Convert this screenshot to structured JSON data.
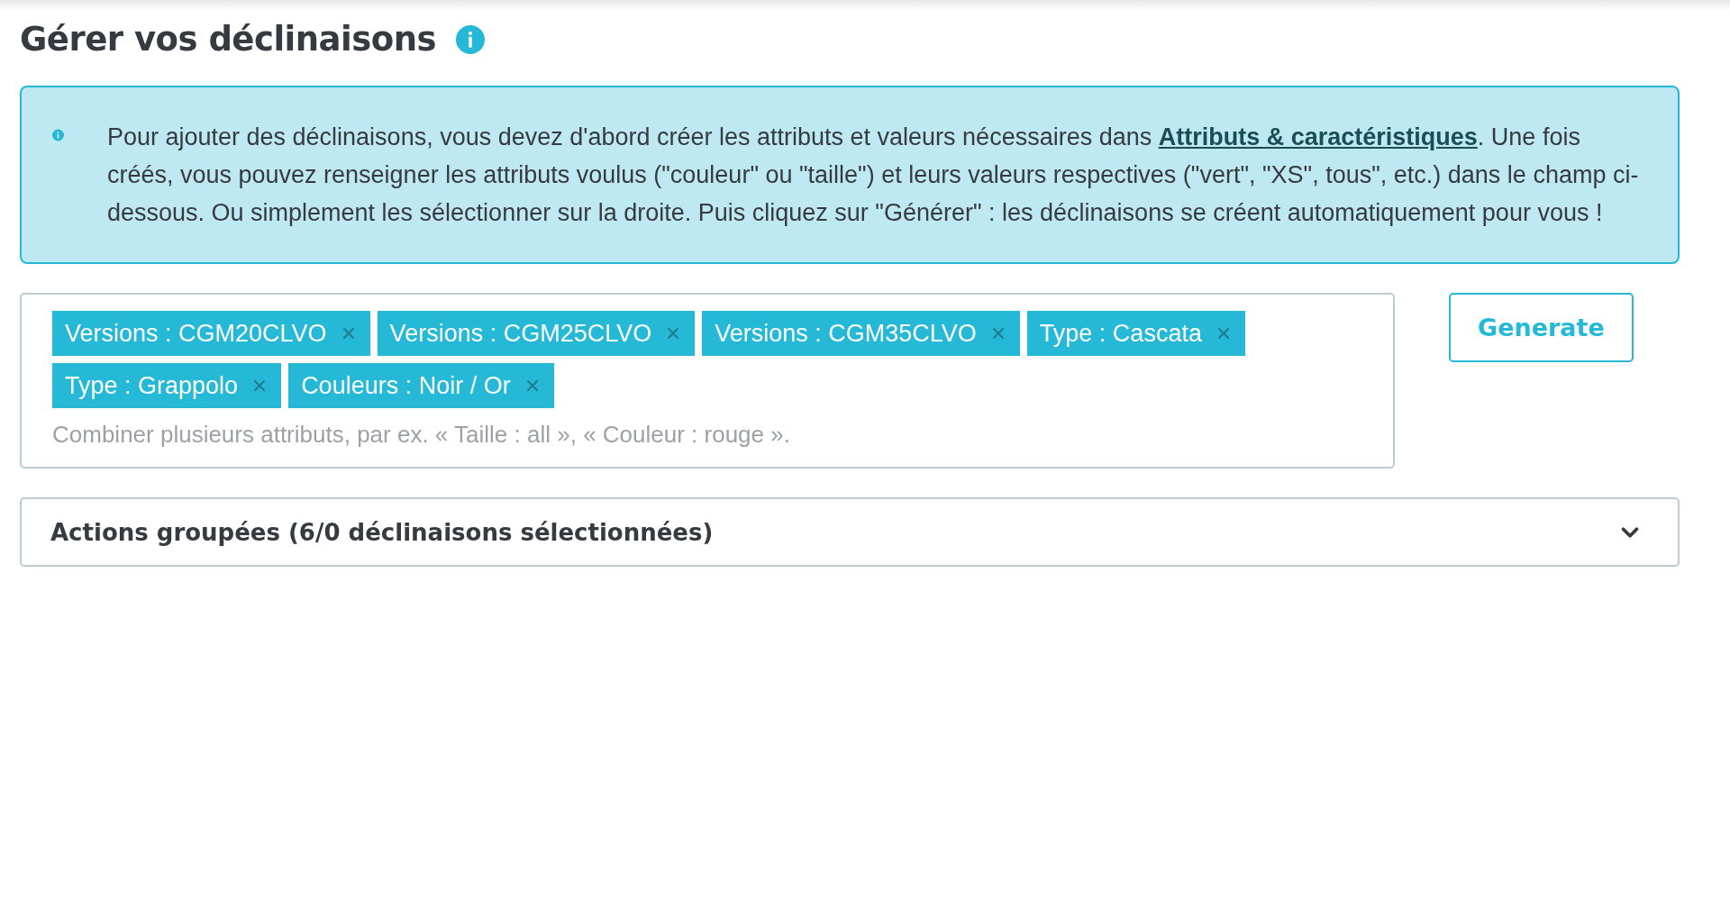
{
  "title": "Gérer vos déclinaisons",
  "info": {
    "before": "Pour ajouter des déclinaisons, vous devez d'abord créer les attributs et valeurs nécessaires dans ",
    "link": "Attributs & caractéristiques",
    "after": ". Une fois créés, vous pouvez renseigner les attributs voulus (\"couleur\" ou \"taille\") et leurs valeurs respectives (\"vert\", \"XS\", tous\", etc.) dans le champ ci-dessous. Ou simplement les sélectionner sur la droite. Puis cliquez sur \"Générer\" : les déclinaisons se créent automatiquement pour vous !"
  },
  "tags": [
    "Versions : CGM20CLVO",
    "Versions : CGM25CLVO",
    "Versions : CGM35CLVO",
    "Type : Cascata",
    "Type : Grappolo",
    "Couleurs : Noir / Or"
  ],
  "tag_input": {
    "placeholder": "Combiner plusieurs attributs, par ex. « Taille : all », « Couleur : rouge »."
  },
  "generate_button": "Generate",
  "bulk_actions": {
    "label": "Actions groupées (6/0 déclinaisons sélectionnées)",
    "expanded": false
  }
}
